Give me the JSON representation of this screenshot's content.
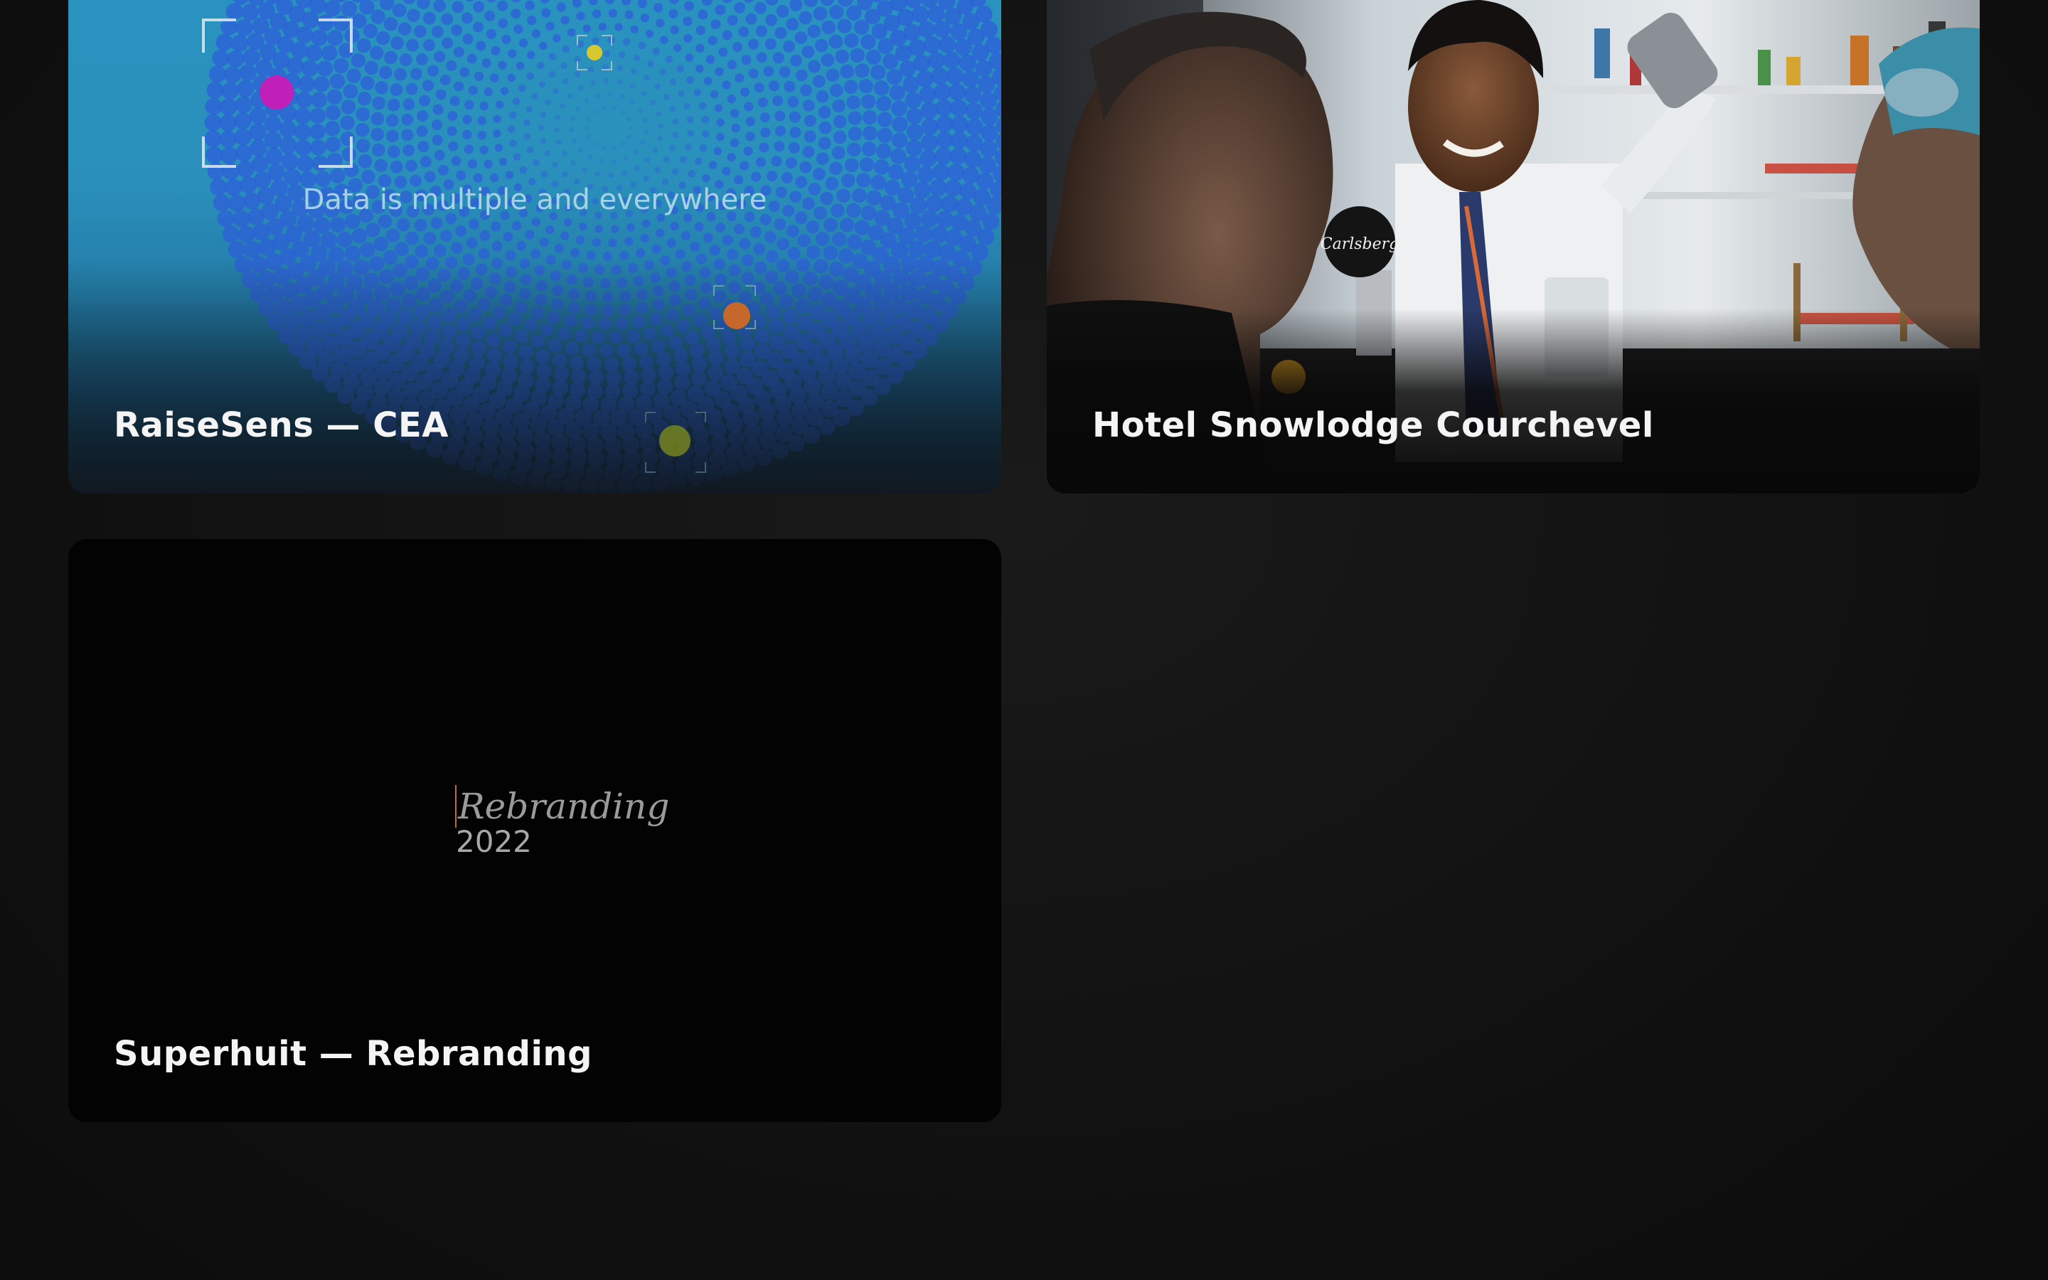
{
  "projects": [
    {
      "title": "RaiseSens — CEA",
      "tagline": "Data is multiple and everywhere"
    },
    {
      "title": "Hotel Snowlodge Courchevel",
      "sign": "Carlsberg"
    },
    {
      "title": "Superhuit — Rebranding",
      "word": "Rebranding",
      "year": "2022"
    }
  ],
  "colors": {
    "page_bg": "#121212",
    "raisesens_blue": "#2a93bf",
    "dot_blue": "#2e5fd8",
    "accent_magenta": "#c020b8",
    "accent_yellow": "#d8c830",
    "accent_orange": "#d86a20",
    "accent_olive": "#7a8a1c"
  }
}
